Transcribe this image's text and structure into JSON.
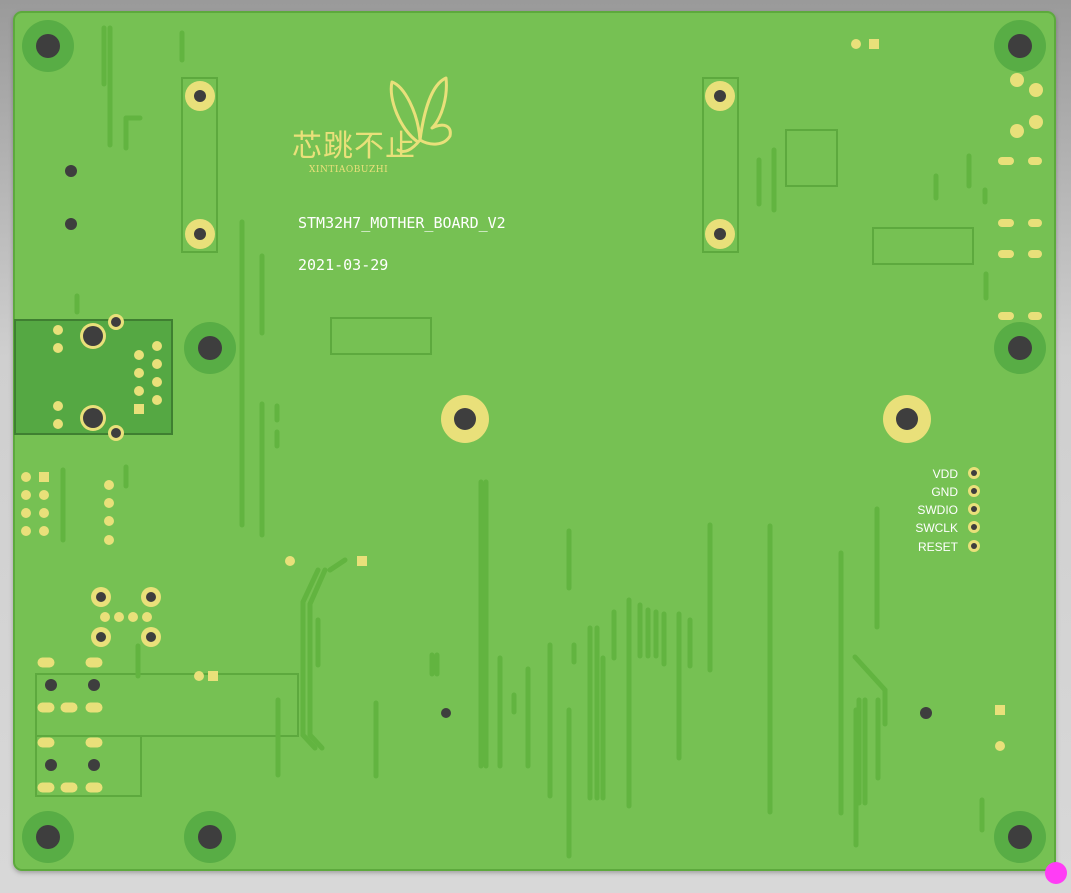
{
  "board": {
    "name": "STM32H7_MOTHER_BOARD_V2",
    "date": "2021-03-29",
    "logo_cn": "芯跳不止",
    "logo_en": "XINTIAOBUZHI",
    "logo_icon": "butterfly-icon"
  },
  "swd_header": {
    "pins": [
      "VDD",
      "GND",
      "SWDIO",
      "SWCLK",
      "RESET"
    ]
  },
  "colors": {
    "board": "#76c152",
    "board_edge": "#5da93e",
    "trace": "#6ab846",
    "pad": "#e9e07a",
    "mounting_ring": "#58ad45",
    "silkscreen": "#ffffff",
    "marker": "#ff3df5"
  }
}
